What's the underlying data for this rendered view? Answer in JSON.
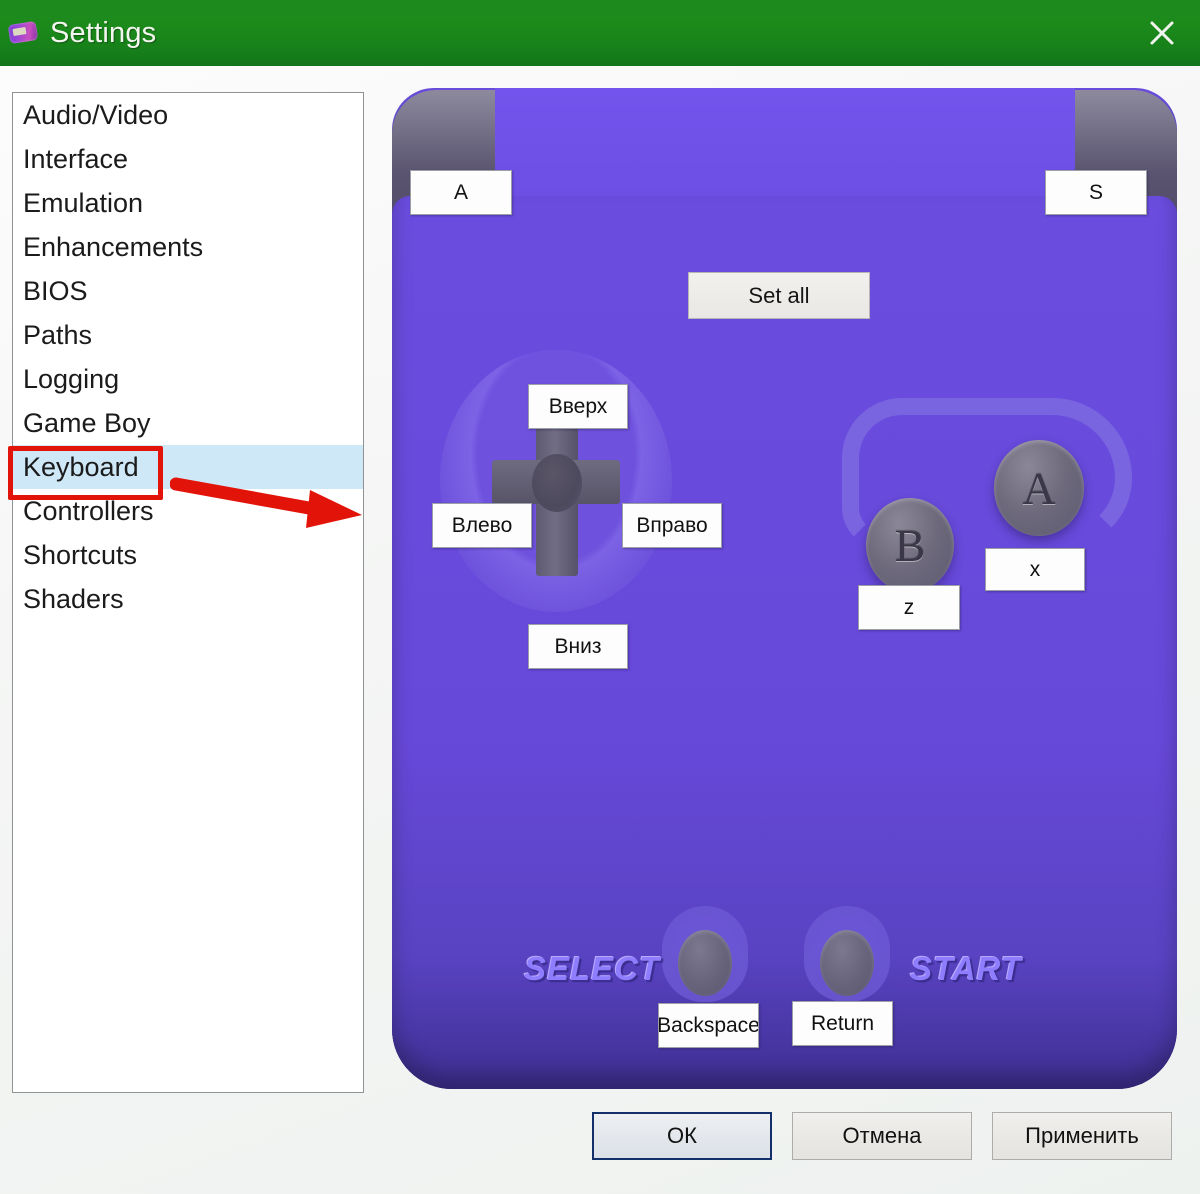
{
  "window": {
    "title": "Settings",
    "icon": "gba-console-icon",
    "close_label": "close-icon",
    "titlebar_color": "#1b8a1b"
  },
  "sidebar": {
    "items": [
      {
        "label": "Audio/Video",
        "selected": false
      },
      {
        "label": "Interface",
        "selected": false
      },
      {
        "label": "Emulation",
        "selected": false
      },
      {
        "label": "Enhancements",
        "selected": false
      },
      {
        "label": "BIOS",
        "selected": false
      },
      {
        "label": "Paths",
        "selected": false
      },
      {
        "label": "Logging",
        "selected": false
      },
      {
        "label": "Game Boy",
        "selected": false
      },
      {
        "label": "Keyboard",
        "selected": true
      },
      {
        "label": "Controllers",
        "selected": false
      },
      {
        "label": "Shortcuts",
        "selected": false
      },
      {
        "label": "Shaders",
        "selected": false
      }
    ],
    "selected_highlight_color": "#cfe8f7"
  },
  "annotation": {
    "box_color": "#e2140a",
    "arrow_color": "#e2140a",
    "target": "Keyboard"
  },
  "keyboard_panel": {
    "set_all_label": "Set all",
    "face_button_b_glyph": "B",
    "face_button_a_glyph": "A",
    "select_label": "SELECT",
    "start_label": "START",
    "bindings": [
      {
        "control": "L",
        "value": "A"
      },
      {
        "control": "R",
        "value": "S"
      },
      {
        "control": "Up",
        "value": "Вверх"
      },
      {
        "control": "Left",
        "value": "Влево"
      },
      {
        "control": "Right",
        "value": "Вправо"
      },
      {
        "control": "Down",
        "value": "Вниз"
      },
      {
        "control": "B",
        "value": "z"
      },
      {
        "control": "A",
        "value": "x"
      },
      {
        "control": "Select",
        "value": "Backspace"
      },
      {
        "control": "Start",
        "value": "Return"
      }
    ],
    "body_color": "#6a4ddf"
  },
  "footer": {
    "ok_label": "ОК",
    "cancel_label": "Отмена",
    "apply_label": "Применить"
  }
}
